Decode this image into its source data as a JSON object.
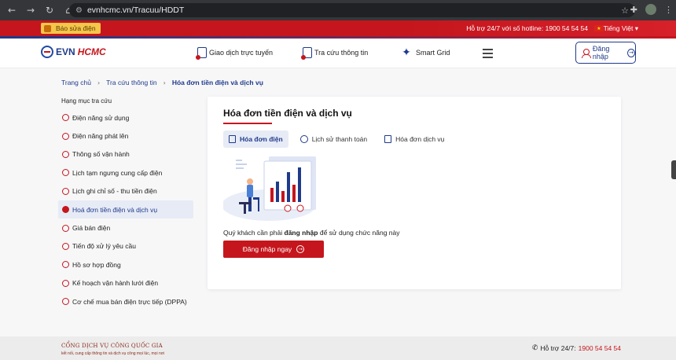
{
  "browser": {
    "url": "evnhcmc.vn/Tracuu/HDDT"
  },
  "topbar": {
    "report_label": "Báo sửa điện",
    "hotline": "Hỗ trợ 24/7 với số hotline: 1900 54 54 54",
    "language": "Tiếng Việt ▾"
  },
  "header": {
    "logo_evn": "EVN",
    "logo_hcmc": "HCMC",
    "menu": [
      {
        "label": "Giao dịch trực tuyến",
        "icon": "phone-icon"
      },
      {
        "label": "Tra cứu thông tin",
        "icon": "search-doc-icon"
      },
      {
        "label": "Smart Grid",
        "icon": "star-icon"
      }
    ],
    "login_label": "Đăng nhập"
  },
  "breadcrumb": {
    "items": [
      "Trang chủ",
      "Tra cứu thông tin",
      "Hóa đơn tiền điện và dịch vụ"
    ]
  },
  "sidebar": {
    "title": "Hạng mục tra cứu",
    "items": [
      {
        "label": "Điện năng sử dụng",
        "active": false
      },
      {
        "label": "Điện năng phát lên",
        "active": false
      },
      {
        "label": "Thông số vận hành",
        "active": false
      },
      {
        "label": "Lịch tạm ngưng cung cấp điện",
        "active": false
      },
      {
        "label": "Lịch ghi chỉ số - thu tiền điện",
        "active": false
      },
      {
        "label": "Hoá đơn tiền điện và dịch vụ",
        "active": true
      },
      {
        "label": "Giá bán điện",
        "active": false
      },
      {
        "label": "Tiến độ xử lý yêu cầu",
        "active": false
      },
      {
        "label": "Hồ sơ hợp đồng",
        "active": false
      },
      {
        "label": "Kế hoạch vận hành lưới điện",
        "active": false
      },
      {
        "label": "Cơ chế mua bán điện trực tiếp (DPPA)",
        "active": false
      }
    ]
  },
  "main": {
    "title": "Hóa đơn tiền điện và dịch vụ",
    "tabs": [
      {
        "label": "Hóa đơn điện",
        "active": true
      },
      {
        "label": "Lịch sử thanh toán",
        "active": false
      },
      {
        "label": "Hóa đơn dịch vụ",
        "active": false
      }
    ],
    "message_pre": "Quý khách cần phải ",
    "message_bold": "đăng nhập",
    "message_post": " để sử dụng chức năng này",
    "cta_label": "Đăng nhập ngay"
  },
  "footer": {
    "brand": "CỔNG DỊCH VỤ CÔNG QUỐC GIA",
    "tagline": "kết nối, cung cấp thông tin và dịch vụ công mọi lúc, mọi nơi",
    "hotline_label": "Hỗ trợ 24/7:",
    "hotline_number": "1900 54 54 54"
  },
  "colors": {
    "brand_red": "#c5161d",
    "brand_blue": "#1f3a8a",
    "active_bg": "#e7ebf6"
  }
}
